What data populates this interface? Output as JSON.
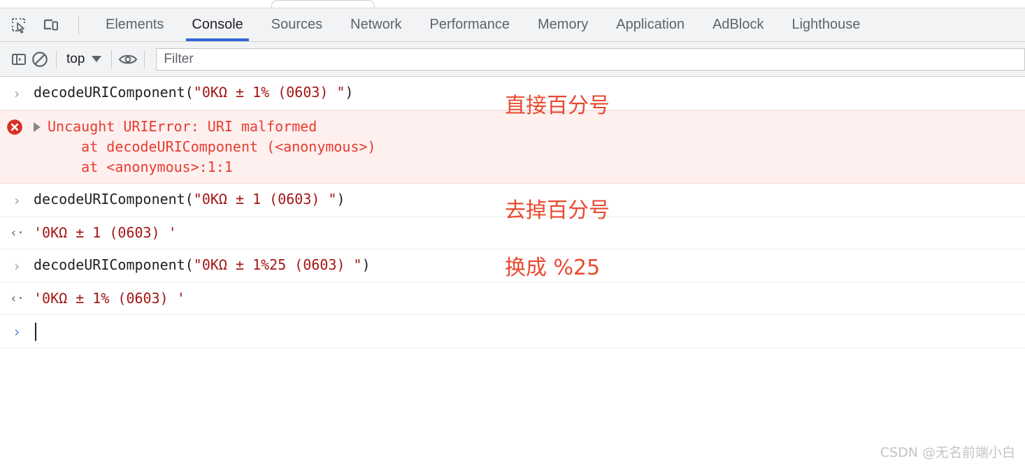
{
  "tabbar": {
    "icons": [
      {
        "name": "inspect-element-icon",
        "label": "Inspect element"
      },
      {
        "name": "device-toolbar-icon",
        "label": "Toggle device toolbar"
      }
    ],
    "tabs": [
      {
        "label": "Elements",
        "active": false
      },
      {
        "label": "Console",
        "active": true
      },
      {
        "label": "Sources",
        "active": false
      },
      {
        "label": "Network",
        "active": false
      },
      {
        "label": "Performance",
        "active": false
      },
      {
        "label": "Memory",
        "active": false
      },
      {
        "label": "Application",
        "active": false
      },
      {
        "label": "AdBlock",
        "active": false
      },
      {
        "label": "Lighthouse",
        "active": false
      }
    ],
    "active_tab": "Console",
    "accent_color": "#3367d6"
  },
  "filterbar": {
    "sidebar_toggle_label": "Show console sidebar",
    "clear_console_label": "Clear console",
    "context": "top",
    "eye_label": "Create live expression",
    "filter_placeholder": "Filter",
    "filter_value": ""
  },
  "console": {
    "input_marker": "›",
    "output_marker": "‹·",
    "prompt_marker": "›",
    "string_color": "#a31515",
    "error_color": "#e83b2f",
    "entries": [
      {
        "type": "command",
        "fn": "decodeURIComponent(",
        "arg": "\"0KΩ ± 1% (0603) \"",
        "close": ")"
      },
      {
        "type": "error",
        "icon": "error-circle-icon",
        "title": "Uncaught URIError: URI malformed",
        "stack": [
          "    at decodeURIComponent (<anonymous>)",
          "    at <anonymous>:1:1"
        ]
      },
      {
        "type": "command",
        "fn": "decodeURIComponent(",
        "arg": "\"0KΩ ± 1 (0603) \"",
        "close": ")"
      },
      {
        "type": "result",
        "value": "'0KΩ ± 1 (0603) '"
      },
      {
        "type": "command",
        "fn": "decodeURIComponent(",
        "arg": "\"0KΩ ± 1%25 (0603) \"",
        "close": ")"
      },
      {
        "type": "result",
        "value": "'0KΩ ± 1% (0603) '"
      },
      {
        "type": "prompt",
        "value": ""
      }
    ]
  },
  "annotations": [
    {
      "text": "直接百分号"
    },
    {
      "text": "去掉百分号"
    },
    {
      "text": "换成 %25"
    }
  ],
  "watermark": {
    "text": "CSDN @无名前端小白"
  }
}
